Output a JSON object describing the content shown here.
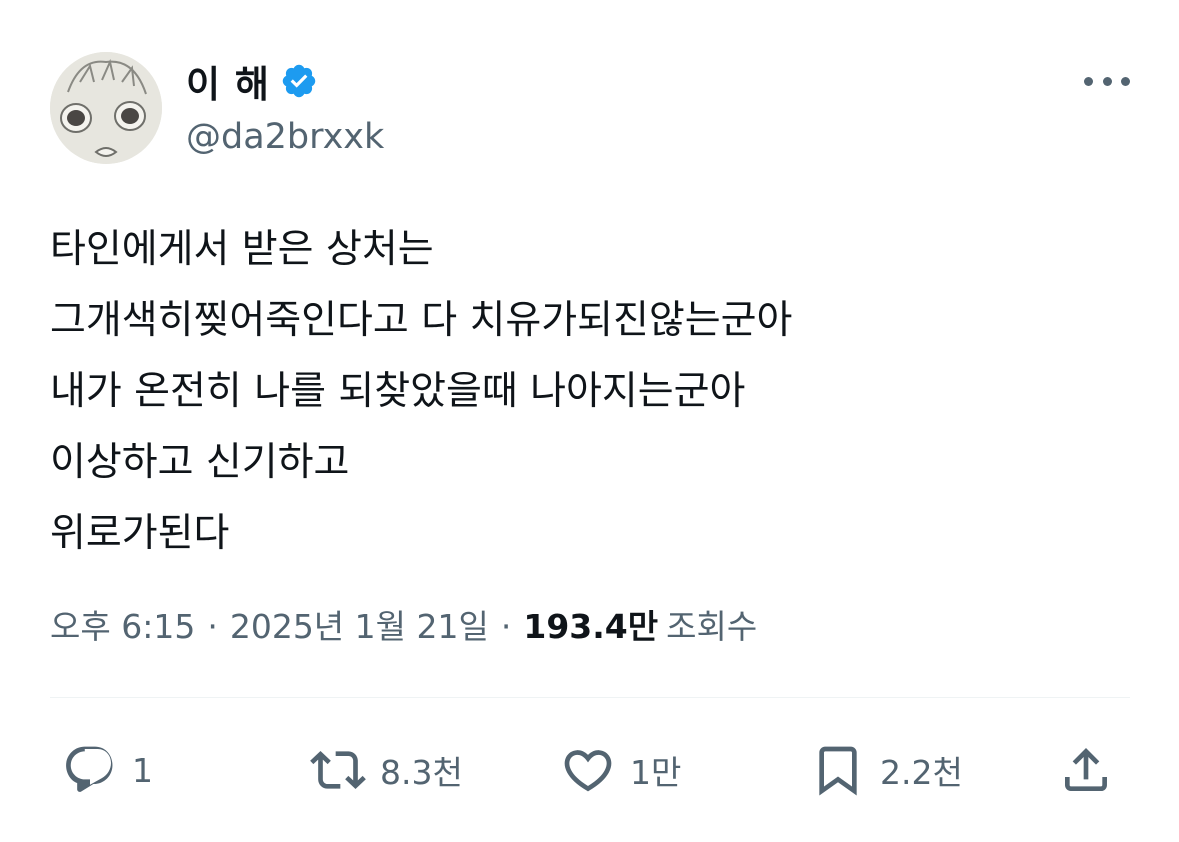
{
  "author": {
    "display_name": "이 해",
    "handle": "@da2brxxk",
    "verified_icon": "verified-badge-icon",
    "verified_color": "#1d9bf0"
  },
  "tweet": {
    "lines": [
      "타인에게서 받은 상처는",
      "그개색히찢어죽인다고 다 치유가되진않는군아",
      "내가 온전히 나를 되찾았을때 나아지는군아",
      "이상하고 신기하고",
      "위로가된다"
    ]
  },
  "meta": {
    "time": "오후 6:15",
    "separator": "·",
    "date": "2025년 1월 21일",
    "views_count": "193.4만",
    "views_label": "조회수"
  },
  "actions": {
    "reply": {
      "icon": "reply-icon",
      "count": "1"
    },
    "retweet": {
      "icon": "retweet-icon",
      "count": "8.3천"
    },
    "like": {
      "icon": "heart-icon",
      "count": "1만"
    },
    "bookmark": {
      "icon": "bookmark-icon",
      "count": "2.2천"
    },
    "share": {
      "icon": "share-icon"
    }
  },
  "colors": {
    "text": "#0f1419",
    "secondary": "#536471",
    "verified": "#1d9bf0",
    "divider": "#eff3f4"
  }
}
